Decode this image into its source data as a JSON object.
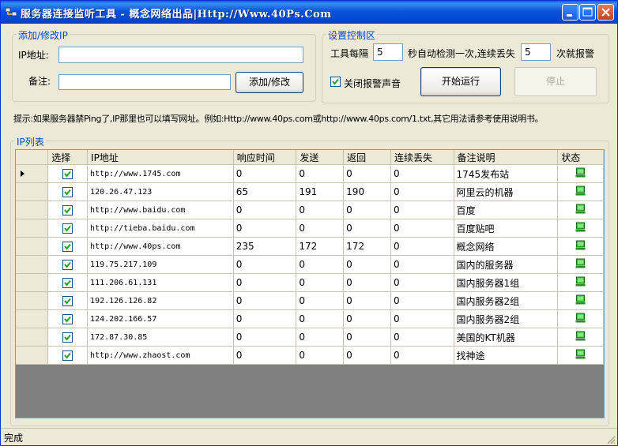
{
  "window": {
    "title": "服务器连接监听工具 - 概念网络出品|Http://Www.40Ps.Com"
  },
  "add_group": {
    "title": "添加/修改IP",
    "ip_label": "IP地址:",
    "ip_value": "",
    "note_label": "备注:",
    "note_value": "",
    "add_button": "添加/修改"
  },
  "control_group": {
    "title": "设置控制区",
    "interval_label": "工具每隔",
    "interval_value": "5",
    "middle_label": "秒自动检测一次,连续丢失",
    "loss_value": "5",
    "alarm_label": "次就报警",
    "mute_checkbox_label": "关闭报警声音",
    "mute_checked": true,
    "start_button": "开始运行",
    "stop_button": "停止"
  },
  "hint": "提示:如果服务器禁Ping了,IP那里也可以填写网址。例如:Http://www.40ps.com或http://www.40ps.com/1.txt,其它用法请参考使用说明书。",
  "list_group": {
    "title": "IP列表",
    "columns": [
      "选择",
      "IP地址",
      "响应时间",
      "发送",
      "返回",
      "连续丢失",
      "备注说明",
      "状态"
    ],
    "rows": [
      {
        "checked": true,
        "ip": "http://www.1745.com",
        "response": "0",
        "sent": "0",
        "returned": "0",
        "lost": "0",
        "note": "1745发布站",
        "status": "online"
      },
      {
        "checked": true,
        "ip": "120.26.47.123",
        "response": "65",
        "sent": "191",
        "returned": "190",
        "lost": "0",
        "note": "阿里云的机器",
        "status": "online"
      },
      {
        "checked": true,
        "ip": "http://www.baidu.com",
        "response": "0",
        "sent": "0",
        "returned": "0",
        "lost": "0",
        "note": "百度",
        "status": "online"
      },
      {
        "checked": true,
        "ip": "http://tieba.baidu.com",
        "response": "0",
        "sent": "0",
        "returned": "0",
        "lost": "0",
        "note": "百度贴吧",
        "status": "online"
      },
      {
        "checked": true,
        "ip": "http://www.40ps.com",
        "response": "235",
        "sent": "172",
        "returned": "172",
        "lost": "0",
        "note": "概念网络",
        "status": "online"
      },
      {
        "checked": true,
        "ip": "119.75.217.109",
        "response": "0",
        "sent": "0",
        "returned": "0",
        "lost": "0",
        "note": "国内的服务器",
        "status": "online"
      },
      {
        "checked": true,
        "ip": "111.206.61.131",
        "response": "0",
        "sent": "0",
        "returned": "0",
        "lost": "0",
        "note": "国内服务器1组",
        "status": "online"
      },
      {
        "checked": true,
        "ip": "192.126.126.82",
        "response": "0",
        "sent": "0",
        "returned": "0",
        "lost": "0",
        "note": "国内服务器2组",
        "status": "online"
      },
      {
        "checked": true,
        "ip": "124.202.166.57",
        "response": "0",
        "sent": "0",
        "returned": "0",
        "lost": "0",
        "note": "国内服务器2组",
        "status": "online"
      },
      {
        "checked": true,
        "ip": "172.87.30.85",
        "response": "0",
        "sent": "0",
        "returned": "0",
        "lost": "0",
        "note": "美国的KT机器",
        "status": "online"
      },
      {
        "checked": true,
        "ip": "http://www.zhaost.com",
        "response": "0",
        "sent": "0",
        "returned": "0",
        "lost": "0",
        "note": "找神途",
        "status": "online"
      }
    ]
  },
  "statusbar": {
    "text": "完成"
  }
}
